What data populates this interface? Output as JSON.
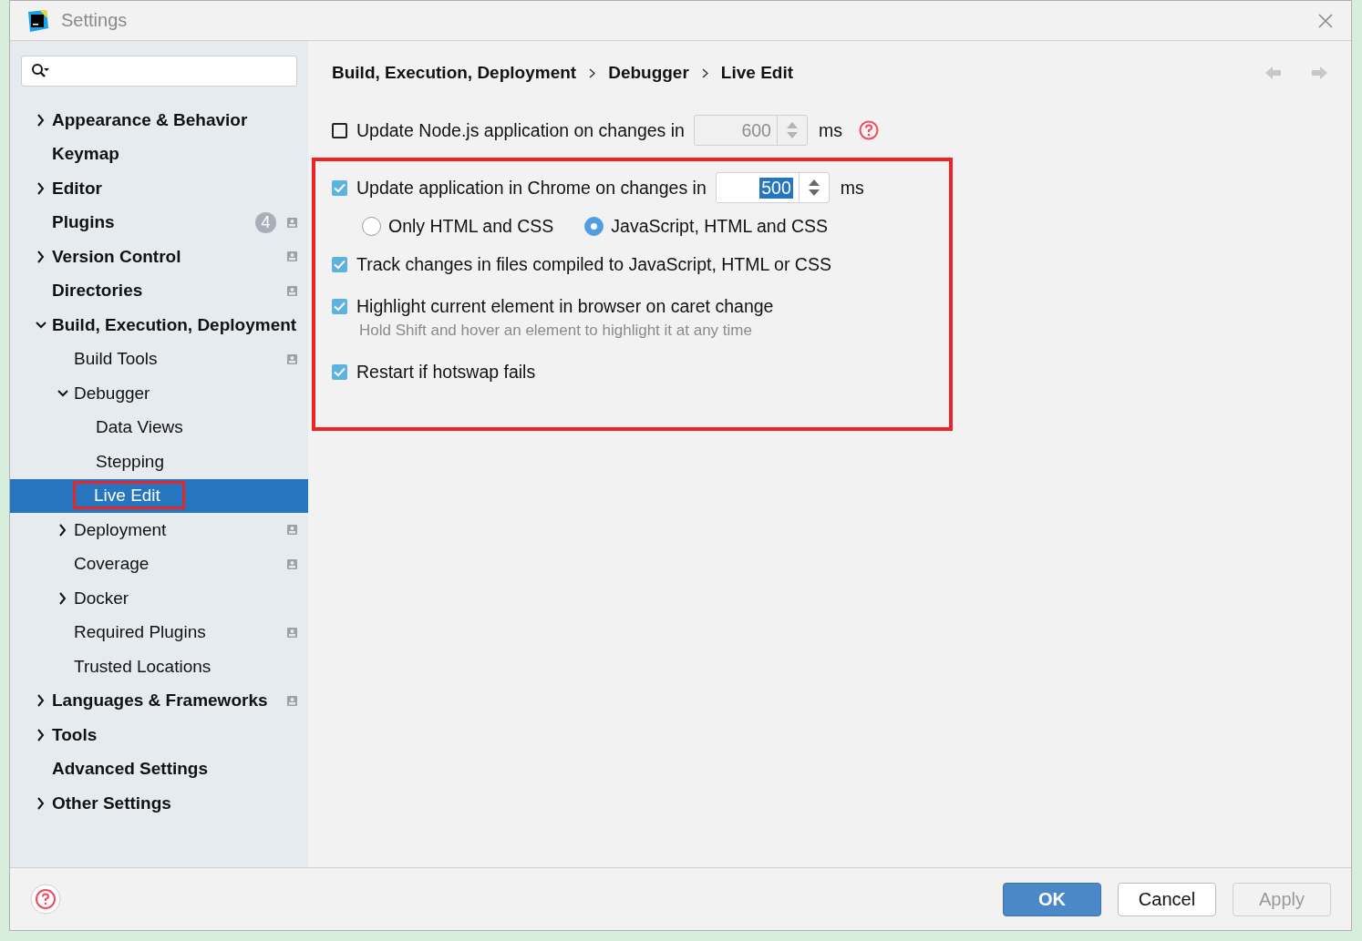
{
  "window": {
    "title": "Settings"
  },
  "sidebar": {
    "items": [
      {
        "label": "Appearance & Behavior",
        "expanded": false,
        "expandable": true,
        "project_icon": false,
        "selected": false
      },
      {
        "label": "Keymap",
        "expandable": false,
        "project_icon": false,
        "selected": false
      },
      {
        "label": "Editor",
        "expanded": false,
        "expandable": true,
        "project_icon": false,
        "selected": false
      },
      {
        "label": "Plugins",
        "expandable": false,
        "project_icon": true,
        "count": "4",
        "selected": false
      },
      {
        "label": "Version Control",
        "expanded": false,
        "expandable": true,
        "project_icon": true,
        "selected": false
      },
      {
        "label": "Directories",
        "expandable": false,
        "project_icon": true,
        "selected": false
      },
      {
        "label": "Build, Execution, Deployment",
        "expanded": true,
        "expandable": true,
        "project_icon": false,
        "selected": false,
        "children": [
          {
            "label": "Build Tools",
            "expandable": false,
            "project_icon": true,
            "selected": false
          },
          {
            "label": "Debugger",
            "expanded": true,
            "expandable": true,
            "project_icon": false,
            "selected": false,
            "children": [
              {
                "label": "Data Views",
                "expandable": false,
                "project_icon": false,
                "selected": false
              },
              {
                "label": "Stepping",
                "expandable": false,
                "project_icon": false,
                "selected": false
              },
              {
                "label": "Live Edit",
                "expandable": false,
                "project_icon": false,
                "selected": true,
                "highlighted": true
              }
            ]
          },
          {
            "label": "Deployment",
            "expanded": false,
            "expandable": true,
            "project_icon": true,
            "selected": false
          },
          {
            "label": "Coverage",
            "expandable": false,
            "project_icon": true,
            "selected": false
          },
          {
            "label": "Docker",
            "expanded": false,
            "expandable": true,
            "project_icon": false,
            "selected": false
          },
          {
            "label": "Required Plugins",
            "expandable": false,
            "project_icon": true,
            "selected": false
          },
          {
            "label": "Trusted Locations",
            "expandable": false,
            "project_icon": false,
            "selected": false
          }
        ]
      },
      {
        "label": "Languages & Frameworks",
        "expanded": false,
        "expandable": true,
        "project_icon": true,
        "selected": false
      },
      {
        "label": "Tools",
        "expanded": false,
        "expandable": true,
        "project_icon": false,
        "selected": false
      },
      {
        "label": "Advanced Settings",
        "expandable": false,
        "project_icon": false,
        "selected": false
      },
      {
        "label": "Other Settings",
        "expanded": false,
        "expandable": true,
        "project_icon": false,
        "selected": false
      }
    ]
  },
  "breadcrumb": [
    "Build, Execution, Deployment",
    "Debugger",
    "Live Edit"
  ],
  "options": [
    {
      "kind": "spinner",
      "label": "Update Node.js application on changes in",
      "checked": false,
      "value": "600",
      "value_selected": false,
      "unit": "ms",
      "disabled": true,
      "help": true
    },
    {
      "kind": "group",
      "highlighted": true,
      "children": [
        {
          "kind": "spinner",
          "label": "Update application in Chrome on changes in",
          "checked": true,
          "value": "500",
          "value_selected": true,
          "unit": "ms",
          "disabled": false,
          "help": false
        },
        {
          "kind": "radios",
          "choices": [
            {
              "label": "Only HTML and CSS",
              "selected": false
            },
            {
              "label": "JavaScript, HTML and CSS",
              "selected": true
            }
          ]
        },
        {
          "kind": "checkbox",
          "label": "Track changes in files compiled to JavaScript, HTML or CSS",
          "checked": true
        },
        {
          "kind": "checkbox",
          "label": "Highlight current element in browser on caret change",
          "checked": true,
          "hint": "Hold Shift and hover an element to highlight it at any time"
        },
        {
          "kind": "checkbox",
          "label": "Restart if hotswap fails",
          "checked": true
        }
      ]
    }
  ],
  "buttons": [
    {
      "label": "OK",
      "kind": "primary",
      "disabled": false
    },
    {
      "label": "Cancel",
      "kind": "normal",
      "disabled": false
    },
    {
      "label": "Apply",
      "kind": "normal",
      "disabled": true
    }
  ]
}
